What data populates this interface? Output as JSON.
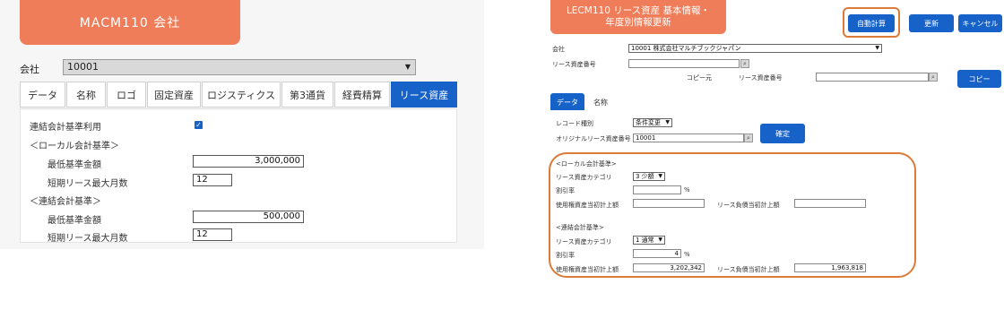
{
  "left": {
    "title": "MACM110 会社",
    "company_label": "会社",
    "company_value": "10001",
    "tabs": [
      "データ",
      "名称",
      "ロゴ",
      "固定資産",
      "ロジスティクス",
      "第3通貨",
      "経費精算",
      "リース資産"
    ],
    "active_tab": "リース資産",
    "consolidated_use_label": "連結会計基準利用",
    "consolidated_use_checked": true,
    "local_header": "＜ローカル会計基準＞",
    "local_min_label": "最低基準金額",
    "local_min_value": "3,000,000",
    "local_short_label": "短期リース最大月数",
    "local_short_value": "12",
    "consol_header": "＜連結会計基準＞",
    "consol_min_label": "最低基準金額",
    "consol_min_value": "500,000",
    "consol_short_label": "短期リース最大月数",
    "consol_short_value": "12"
  },
  "right": {
    "title_line1": "LECM110 リース資産 基本情報・",
    "title_line2": "年度別情報更新",
    "btn_auto": "自動計算",
    "btn_update": "更新",
    "btn_cancel": "キャンセル",
    "company_label": "会社",
    "company_value": "10001 株式会社マルチブックジャパン",
    "asset_no_label": "リース資産番号",
    "asset_no_value": "",
    "copy_from_label": "コピー元",
    "copy_asset_no_label": "リース資産番号",
    "copy_asset_no_value": "",
    "btn_copy": "コピー",
    "tab_data": "データ",
    "tab_name": "名称",
    "record_type_label": "レコード種別",
    "record_type_value": "条件変更",
    "orig_asset_label": "オリジナルリース資産番号",
    "orig_asset_value": "10001",
    "btn_confirm": "確定",
    "local_header": "<ローカル会計基準>",
    "local_category_label": "リース資産カテゴリ",
    "local_category_value": "3 少額",
    "local_rate_label": "割引率",
    "local_rate_value": "",
    "local_rate_unit": "%",
    "local_rou_label": "使用権資産当初計上額",
    "local_rou_value": "",
    "local_liab_label": "リース負債当初計上額",
    "local_liab_value": "",
    "consol_header": "<連結会計基準>",
    "consol_category_label": "リース資産カテゴリ",
    "consol_category_value": "1 通常",
    "consol_rate_label": "割引率",
    "consol_rate_value": "4",
    "consol_rate_unit": "%",
    "consol_rou_label": "使用権資産当初計上額",
    "consol_rou_value": "3,202,342",
    "consol_liab_label": "リース負債当初計上額",
    "consol_liab_value": "1,963,818"
  },
  "colors": {
    "brand_orange": "#ef7d5a",
    "highlight_ring": "#dc7a39",
    "primary_blue": "#1762c9"
  }
}
